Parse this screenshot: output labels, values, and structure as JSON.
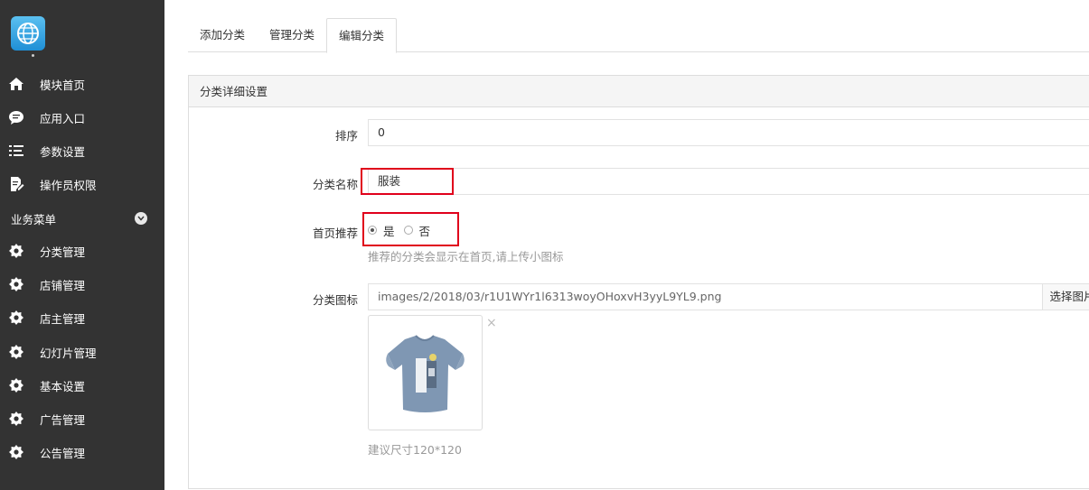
{
  "sidebar": {
    "items": [
      {
        "label": "模块首页",
        "icon": "home-icon"
      },
      {
        "label": "应用入口",
        "icon": "chat-bubble-icon"
      },
      {
        "label": "参数设置",
        "icon": "list-icon"
      },
      {
        "label": "操作员权限",
        "icon": "edit-document-icon"
      }
    ],
    "group_title": "业务菜单",
    "group_items": [
      {
        "label": "分类管理",
        "icon": "gear-icon"
      },
      {
        "label": "店铺管理",
        "icon": "gear-icon"
      },
      {
        "label": "店主管理",
        "icon": "gear-icon"
      },
      {
        "label": "幻灯片管理",
        "icon": "gear-icon"
      },
      {
        "label": "基本设置",
        "icon": "gear-icon"
      },
      {
        "label": "广告管理",
        "icon": "gear-icon"
      },
      {
        "label": "公告管理",
        "icon": "gear-icon"
      }
    ]
  },
  "tabs": [
    {
      "label": "添加分类"
    },
    {
      "label": "管理分类"
    },
    {
      "label": "编辑分类",
      "active": true
    }
  ],
  "panel": {
    "title": "分类详细设置",
    "sort": {
      "label": "排序",
      "value": "0"
    },
    "name": {
      "label": "分类名称",
      "value": "服装"
    },
    "recommend": {
      "label": "首页推荐",
      "options": [
        "是",
        "否"
      ],
      "selected": "是",
      "hint": "推荐的分类会显示在首页,请上传小图标"
    },
    "icon": {
      "label": "分类图标",
      "value": "images/2/2018/03/r1U1WYr1l6313woyOHoxvH3yyL9YL9.png",
      "choose_button": "选择图片",
      "remove": "×",
      "hint": "建议尺寸120*120"
    }
  },
  "colors": {
    "sidebar_bg": "#333333",
    "highlight": "#e0001b",
    "tshirt": "#7f97b3"
  }
}
